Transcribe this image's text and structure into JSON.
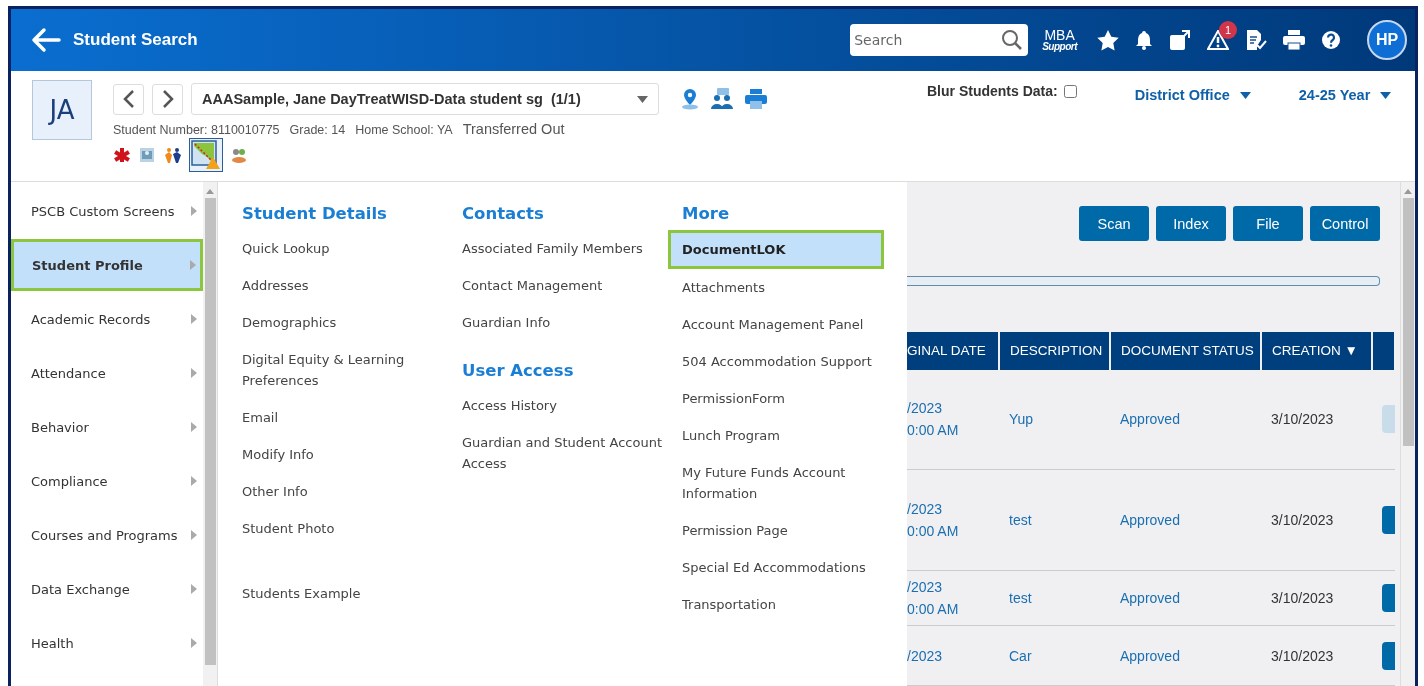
{
  "header": {
    "title": "Student Search",
    "search": {
      "placeholder": "Search"
    },
    "support": [
      "MBA",
      "Support"
    ],
    "alert_count": "1",
    "avatar": "HP"
  },
  "student": {
    "initials": "JA",
    "name": "AAASample, Jane DayTreatWISD-Data student sg  (1/1)",
    "details": [
      "Student Number: 8110010775",
      "Grade: 14",
      "Home School: YA"
    ],
    "status": "Transferred Out",
    "flags": [
      {
        "kind": "medical",
        "selected": false
      },
      {
        "kind": "document",
        "selected": false
      },
      {
        "kind": "people",
        "selected": false
      },
      {
        "kind": "chart",
        "selected": true
      },
      {
        "kind": "group",
        "selected": false
      }
    ]
  },
  "blur": {
    "label": "Blur Students Data:",
    "checked": false
  },
  "district": "District Office",
  "year": "24-25 Year",
  "sidebar": {
    "items": [
      {
        "label": "PSCB Custom Screens",
        "selected": false
      },
      {
        "label": "Student Profile",
        "selected": true
      },
      {
        "label": "Academic Records",
        "selected": false
      },
      {
        "label": "Attendance",
        "selected": false
      },
      {
        "label": "Behavior",
        "selected": false
      },
      {
        "label": "Compliance",
        "selected": false
      },
      {
        "label": "Courses and Programs",
        "selected": false
      },
      {
        "label": "Data Exchange",
        "selected": false
      },
      {
        "label": "Health",
        "selected": false
      }
    ]
  },
  "mega_menu": {
    "columns": [
      {
        "sections": [
          {
            "title": "Student Details",
            "items": [
              {
                "label": "Quick Lookup",
                "selected": false
              },
              {
                "label": "Addresses",
                "selected": false
              },
              {
                "label": "Demographics",
                "selected": false
              },
              {
                "label": "Digital Equity & Learning Preferences",
                "selected": false
              },
              {
                "label": "Email",
                "selected": false
              },
              {
                "label": "Modify Info",
                "selected": false
              },
              {
                "label": "Other Info",
                "selected": false
              },
              {
                "label": "Student Photo",
                "selected": false
              },
              {
                "label": "Students Example",
                "selected": false,
                "gap_before": true
              }
            ]
          }
        ]
      },
      {
        "sections": [
          {
            "title": "Contacts",
            "items": [
              {
                "label": "Associated Family Members",
                "selected": false
              },
              {
                "label": "Contact Management",
                "selected": false
              },
              {
                "label": "Guardian Info",
                "selected": false
              }
            ]
          },
          {
            "title": "User Access",
            "items": [
              {
                "label": "Access History",
                "selected": false
              },
              {
                "label": "Guardian and Student Account Access",
                "selected": false
              }
            ]
          }
        ]
      },
      {
        "sections": [
          {
            "title": "More",
            "items": [
              {
                "label": "DocumentLOK",
                "selected": true
              },
              {
                "label": "Attachments",
                "selected": false
              },
              {
                "label": "Account Management Panel",
                "selected": false
              },
              {
                "label": "504 Accommodation Support",
                "selected": false
              },
              {
                "label": "PermissionForm",
                "selected": false
              },
              {
                "label": "Lunch Program",
                "selected": false
              },
              {
                "label": "My Future Funds Account Information",
                "selected": false
              },
              {
                "label": "Permission Page",
                "selected": false
              },
              {
                "label": "Special Ed Accommodations",
                "selected": false
              },
              {
                "label": "Transportation",
                "selected": false
              }
            ]
          }
        ]
      }
    ]
  },
  "actions": [
    "Scan",
    "Index",
    "File",
    "Control"
  ],
  "table": {
    "columns": [
      "GINAL DATE",
      "DESCRIPTION",
      "DOCUMENT STATUS",
      "CREATION ▼"
    ],
    "rows": [
      {
        "date": [
          "/2023",
          "0:00 AM"
        ],
        "description": "Yup",
        "status": "Approved",
        "creation": "3/10/2023",
        "action_disabled": true
      },
      {
        "date": [
          "/2023",
          "0:00 AM"
        ],
        "description": "test",
        "status": "Approved",
        "creation": "3/10/2023",
        "action_disabled": false
      },
      {
        "date": [
          "/2023",
          "0:00 AM"
        ],
        "description": "test",
        "status": "Approved",
        "creation": "3/10/2023",
        "action_disabled": false
      },
      {
        "date": [
          "/2023"
        ],
        "description": "Car",
        "status": "Approved",
        "creation": "3/10/2023",
        "action_disabled": false
      }
    ]
  }
}
